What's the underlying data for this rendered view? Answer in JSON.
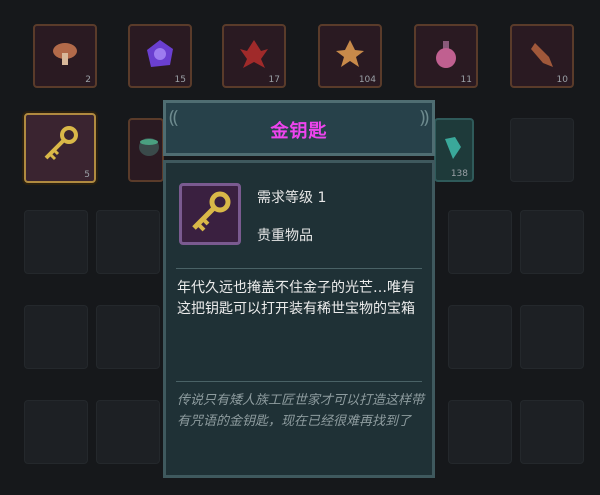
{
  "inventory": {
    "row1": [
      {
        "icon": "mushroom-icon",
        "count": "2"
      },
      {
        "icon": "purple-gem-icon",
        "count": "15"
      },
      {
        "icon": "red-leaf-icon",
        "count": "17"
      },
      {
        "icon": "orange-leaf-icon",
        "count": "104"
      },
      {
        "icon": "potion-flask-icon",
        "count": "11"
      },
      {
        "icon": "root-icon",
        "count": "10"
      }
    ],
    "row2": [
      {
        "icon": "gold-key-icon",
        "count": "5"
      },
      {
        "icon": "cauldron-icon",
        "count": ""
      },
      {
        "icon": "teal-item-icon",
        "count": "138"
      }
    ]
  },
  "tooltip": {
    "title": "金钥匙",
    "level": "需求等级 1",
    "category": "贵重物品",
    "description": "年代久远也掩盖不住金子的光芒…唯有这把钥匙可以打开装有稀世宝物的宝箱",
    "lore": "传说只有矮人族工匠世家才可以打造这样带有咒语的金钥匙，现在已经很难再找到了"
  },
  "colors": {
    "title": "#ee44ee",
    "key_gold": "#d9b848",
    "panel": "#1f3136"
  }
}
